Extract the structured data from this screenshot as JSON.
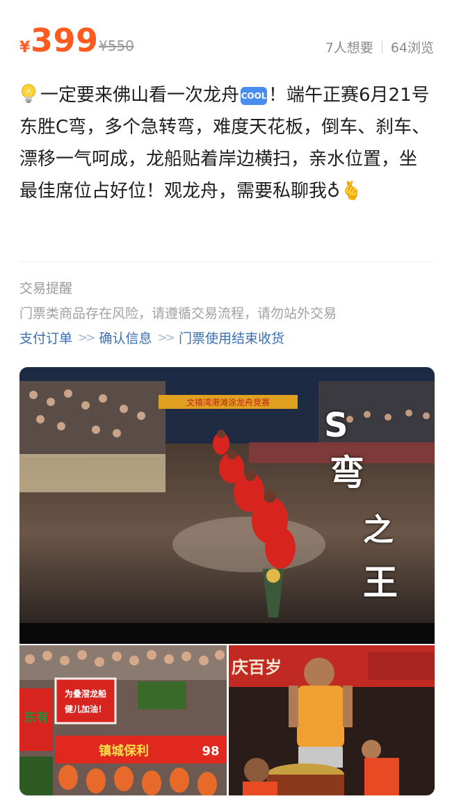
{
  "price": {
    "currency": "¥",
    "value": "399",
    "original": "¥550"
  },
  "stats": {
    "wants": "7人想要",
    "views": "64浏览"
  },
  "description": {
    "part1": "一定要来佛山看一次龙舟",
    "cool_badge": "COOL",
    "part2": "！端午正赛6月21号东胜C弯，多个急转弯，难度天花板，倒车、刹车、漂移一气呵成，龙船贴着岸边横扫，亲水位置，坐最佳席位占好位！观龙舟，需要私聊我♁",
    "hand_emoji": "🫰"
  },
  "trade_tip": {
    "title": "交易提醒",
    "text": "门票类商品存在风险，请遵循交易流程，请勿站外交易",
    "steps": [
      "支付订单",
      "确认信息",
      "门票使用结束收货"
    ],
    "arrow": ">>"
  },
  "photos": {
    "main_overlay": [
      "S",
      "弯",
      "之",
      "王"
    ],
    "banner_top": "文禧湾港滩涂龙舟竞赛",
    "banner_left": "为叠滘龙船健儿加油！",
    "banner_left_small": "东有",
    "banner_right_top": "庆百岁",
    "banner_left_bottom": "镇城保利",
    "banner_left_num": "98"
  },
  "colors": {
    "accent": "#ff5a1f",
    "link": "#3a6fb5"
  }
}
